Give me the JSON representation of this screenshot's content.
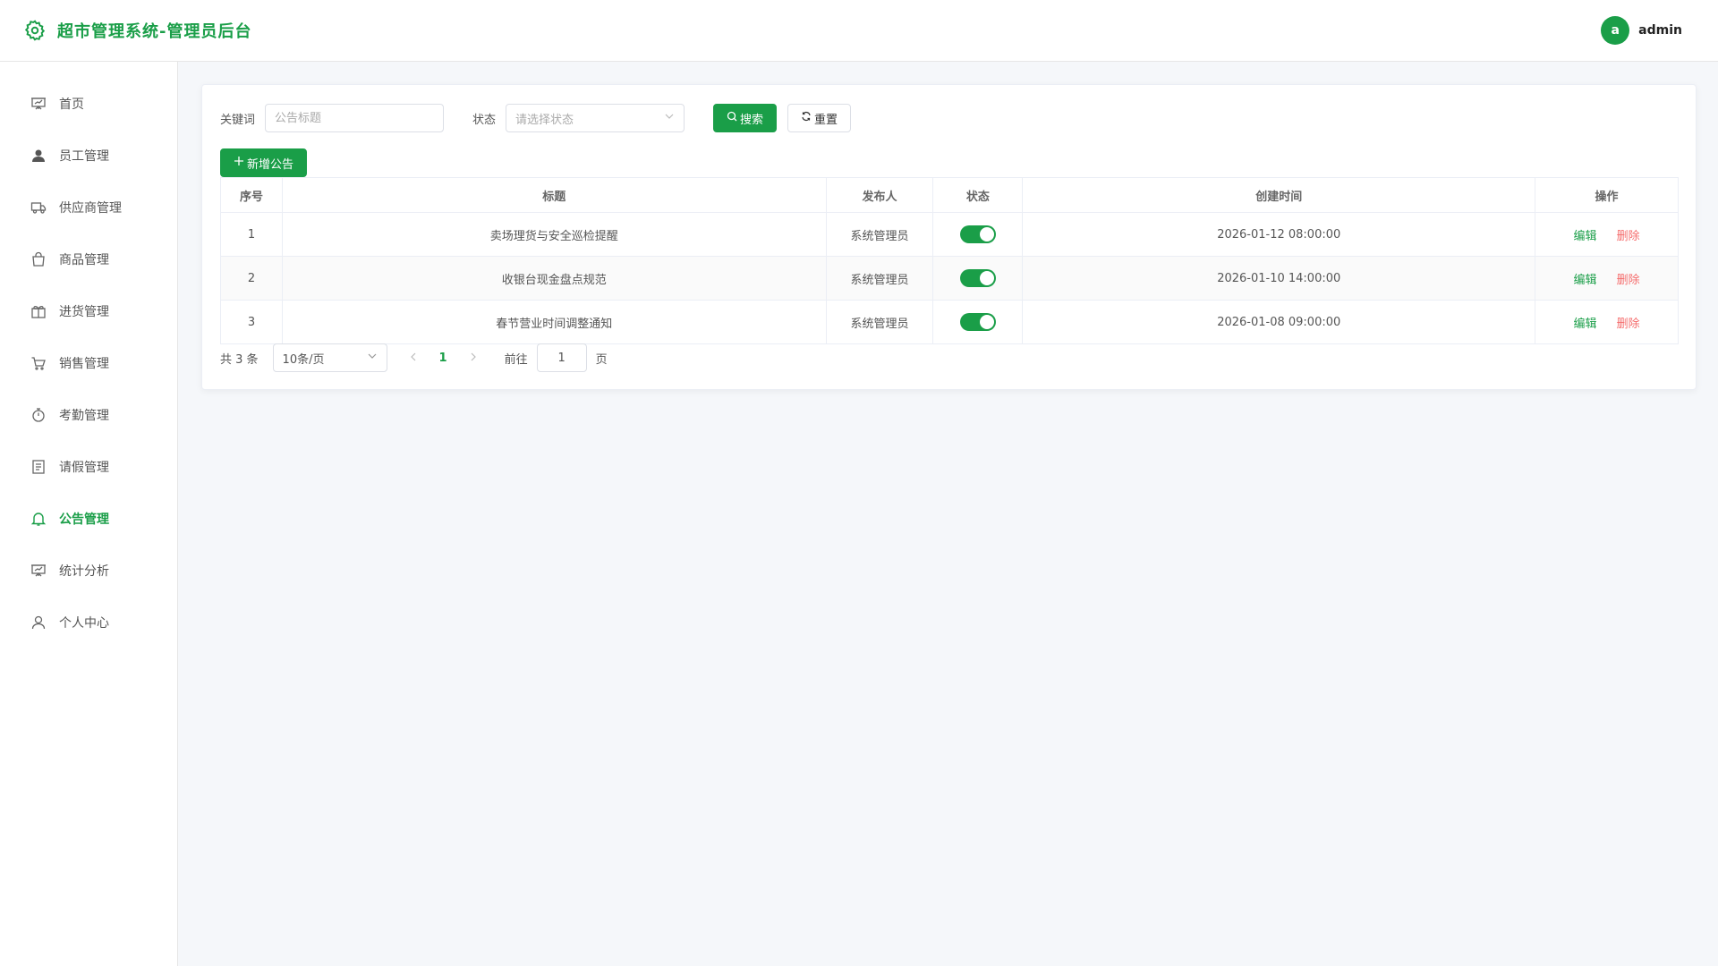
{
  "header": {
    "title": "超市管理系统-管理员后台",
    "avatar_letter": "a",
    "username": "admin",
    "brand_color": "#1a9e48"
  },
  "sidebar": {
    "items": [
      {
        "label": "首页",
        "icon": "presentation-icon",
        "active": false
      },
      {
        "label": "员工管理",
        "icon": "user-filled-icon",
        "active": false
      },
      {
        "label": "供应商管理",
        "icon": "truck-icon",
        "active": false
      },
      {
        "label": "商品管理",
        "icon": "shopping-bag-icon",
        "active": false
      },
      {
        "label": "进货管理",
        "icon": "gift-box-icon",
        "active": false
      },
      {
        "label": "销售管理",
        "icon": "cart-icon",
        "active": false
      },
      {
        "label": "考勤管理",
        "icon": "stopwatch-icon",
        "active": false
      },
      {
        "label": "请假管理",
        "icon": "document-icon",
        "active": false
      },
      {
        "label": "公告管理",
        "icon": "bell-icon",
        "active": true
      },
      {
        "label": "统计分析",
        "icon": "presentation-icon",
        "active": false
      },
      {
        "label": "个人中心",
        "icon": "user-icon",
        "active": false
      }
    ]
  },
  "filters": {
    "keyword_label": "关键词",
    "keyword_placeholder": "公告标题",
    "keyword_value": "",
    "status_label": "状态",
    "status_placeholder": "请选择状态",
    "search_label": "搜索",
    "reset_label": "重置"
  },
  "toolbar": {
    "add_label": "新增公告"
  },
  "table": {
    "columns": [
      "序号",
      "标题",
      "发布人",
      "状态",
      "创建时间",
      "操作"
    ],
    "rows": [
      {
        "index": "1",
        "title": "卖场理货与安全巡检提醒",
        "publisher": "系统管理员",
        "status_on": true,
        "created": "2026-01-12 08:00:00",
        "edit": "编辑",
        "delete": "删除"
      },
      {
        "index": "2",
        "title": "收银台现金盘点规范",
        "publisher": "系统管理员",
        "status_on": true,
        "created": "2026-01-10 14:00:00",
        "edit": "编辑",
        "delete": "删除"
      },
      {
        "index": "3",
        "title": "春节营业时间调整通知",
        "publisher": "系统管理员",
        "status_on": true,
        "created": "2026-01-08 09:00:00",
        "edit": "编辑",
        "delete": "删除"
      }
    ]
  },
  "pagination": {
    "total_text": "共 3 条",
    "page_size": "10条/页",
    "current_page": "1",
    "goto_label": "前往",
    "goto_value": "1",
    "page_suffix": "页"
  }
}
